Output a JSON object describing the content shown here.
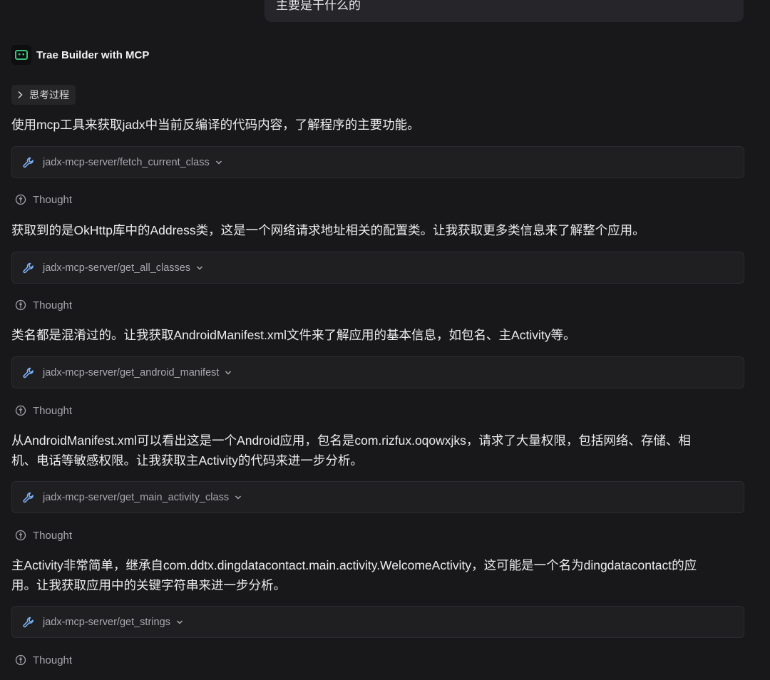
{
  "user_message": {
    "text": "主要是干什么的"
  },
  "agent": {
    "name": "Trae Builder with MCP",
    "icon": "robot-icon",
    "accent": "#3ddc84"
  },
  "thinking": {
    "label": "思考过程",
    "icon": "chevron-right-icon"
  },
  "steps": [
    {
      "text": "使用mcp工具来获取jadx中当前反编译的代码内容，了解程序的主要功能。",
      "tool": "jadx-mcp-server/fetch_current_class",
      "thought_label": "Thought"
    },
    {
      "text": "获取到的是OkHttp库中的Address类，这是一个网络请求地址相关的配置类。让我获取更多类信息来了解整个应用。",
      "tool": "jadx-mcp-server/get_all_classes",
      "thought_label": "Thought"
    },
    {
      "text": "类名都是混淆过的。让我获取AndroidManifest.xml文件来了解应用的基本信息，如包名、主Activity等。",
      "tool": "jadx-mcp-server/get_android_manifest",
      "thought_label": "Thought"
    },
    {
      "text_line1": "从AndroidManifest.xml可以看出这是一个Android应用，包名是com.rizfux.oqowxjks，请求了大量权限，包括网络、存储、相",
      "text_line2": "机、电话等敏感权限。让我获取主Activity的代码来进一步分析。",
      "tool": "jadx-mcp-server/get_main_activity_class",
      "thought_label": "Thought"
    },
    {
      "text_line1": "主Activity非常简单，继承自com.ddtx.dingdatacontact.main.activity.WelcomeActivity，这可能是一个名为dingdatacontact的应",
      "text_line2": "用。让我获取应用中的关键字符串来进一步分析。",
      "tool": "jadx-mcp-server/get_strings",
      "thought_label": "Thought"
    }
  ],
  "icons": {
    "tool": "wrench-icon",
    "tool_caret": "chevron-down-icon",
    "thought": "lightbulb-icon"
  },
  "colors": {
    "background": "#18181a",
    "card": "#1f1f22",
    "text": "#ececee",
    "muted": "#a8a8ae"
  }
}
